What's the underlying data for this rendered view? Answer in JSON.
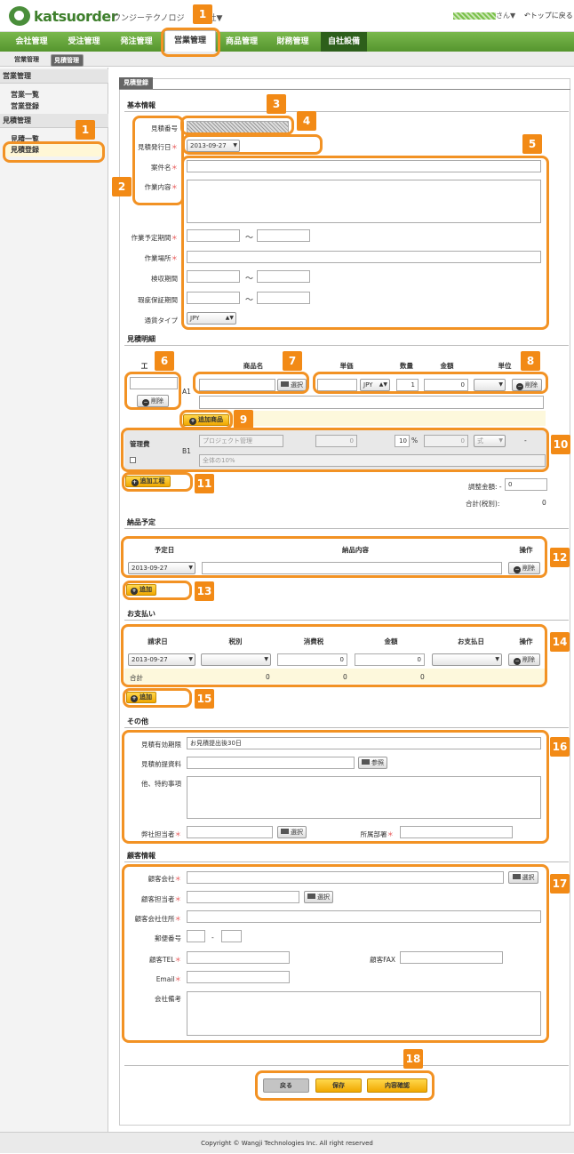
{
  "header": {
    "logo": "katsuorder",
    "company": "ワンジーテクノロジ　式会社▼",
    "user_suffix": "さん▼",
    "top_link": "トップに戻る"
  },
  "gnav": [
    "会社管理",
    "受注管理",
    "発注管理",
    "営業管理",
    "商品管理",
    "財務管理",
    "自社設備"
  ],
  "subnav": [
    "営業管理",
    "見積管理"
  ],
  "sidebar": {
    "head1": "営業管理",
    "link1": "営業一覧",
    "link2": "営業登録",
    "head2": "見積管理",
    "link3": "見積一覧",
    "selected": "見積登録"
  },
  "tab": "見積登録",
  "basic": {
    "title": "基本情報",
    "estimate_no": "見積番号",
    "issue_date": "見積発行日",
    "issue_date_val": "2013-09-27",
    "project": "案件名",
    "work": "作業内容",
    "period": "作業予定期間",
    "place": "作業場所",
    "inspection": "検収期間",
    "warranty": "瑕疵保証期間",
    "currency": "通貨タイプ",
    "currency_val": "JPY",
    "tilde": "～"
  },
  "detail": {
    "title": "見積明細",
    "h_process": "工",
    "h_item": "商品名",
    "h_price": "単価",
    "h_qty": "数量",
    "h_amount": "金額",
    "h_unit": "単位",
    "row_label": "A1",
    "delete": "削除",
    "select": "選択",
    "cur": "JPY",
    "qty": "1",
    "amount": "0",
    "add_item": "追加商品",
    "mgmt": "管理費",
    "b1": "B1",
    "proj_mgmt": "プロジェクト管理",
    "mgmt_price": "0",
    "pct": "10",
    "pct_sign": "%",
    "mgmt_amount": "0",
    "unit_shiki": "式",
    "dash": "-",
    "note": "全体の10%",
    "add_process": "追加工程",
    "adjust_label": "調整金額: -",
    "adjust_val": "0",
    "total_label": "合計(税別):",
    "total_val": "0"
  },
  "delivery": {
    "title": "納品予定",
    "h_date": "予定日",
    "h_content": "納品内容",
    "h_op": "操作",
    "date": "2013-09-27",
    "delete": "削除",
    "add": "追加"
  },
  "payment": {
    "title": "お支払い",
    "h_bill": "請求日",
    "h_tax_type": "税別",
    "h_tax": "消費税",
    "h_amount": "金額",
    "h_pay": "お支払日",
    "h_op": "操作",
    "date": "2013-09-27",
    "tax": "0",
    "amount": "0",
    "delete": "削除",
    "sum": "合計",
    "sum1": "0",
    "sum2": "0",
    "sum3": "0",
    "add": "追加"
  },
  "other": {
    "title": "その他",
    "validity": "見積有効期限",
    "validity_val": "お見積提出後30日",
    "doc": "見積前提資料",
    "ref": "参照",
    "special": "他、特約事項",
    "staff": "弊社担当者",
    "select": "選択",
    "dept": "所属部署"
  },
  "customer": {
    "title": "顧客情報",
    "company": "顧客会社",
    "person": "顧客担当者",
    "address": "顧客会社住所",
    "zip": "郵便番号",
    "zip_dash": "-",
    "tel": "顧客TEL",
    "fax": "顧客FAX",
    "email": "Email",
    "note": "会社備考",
    "select": "選択"
  },
  "actions": {
    "back": "戻る",
    "save": "保存",
    "confirm": "内容確認"
  },
  "footer": "Copyright © Wangji Technologies Inc. All right reserved",
  "badges": [
    "1",
    "1",
    "2",
    "3",
    "4",
    "5",
    "6",
    "7",
    "8",
    "9",
    "10",
    "11",
    "12",
    "13",
    "14",
    "15",
    "16",
    "17",
    "18"
  ],
  "colors": {
    "annotation": "#f29224",
    "nav_green": "#5fa136",
    "button_yellow": "#f5b800"
  }
}
